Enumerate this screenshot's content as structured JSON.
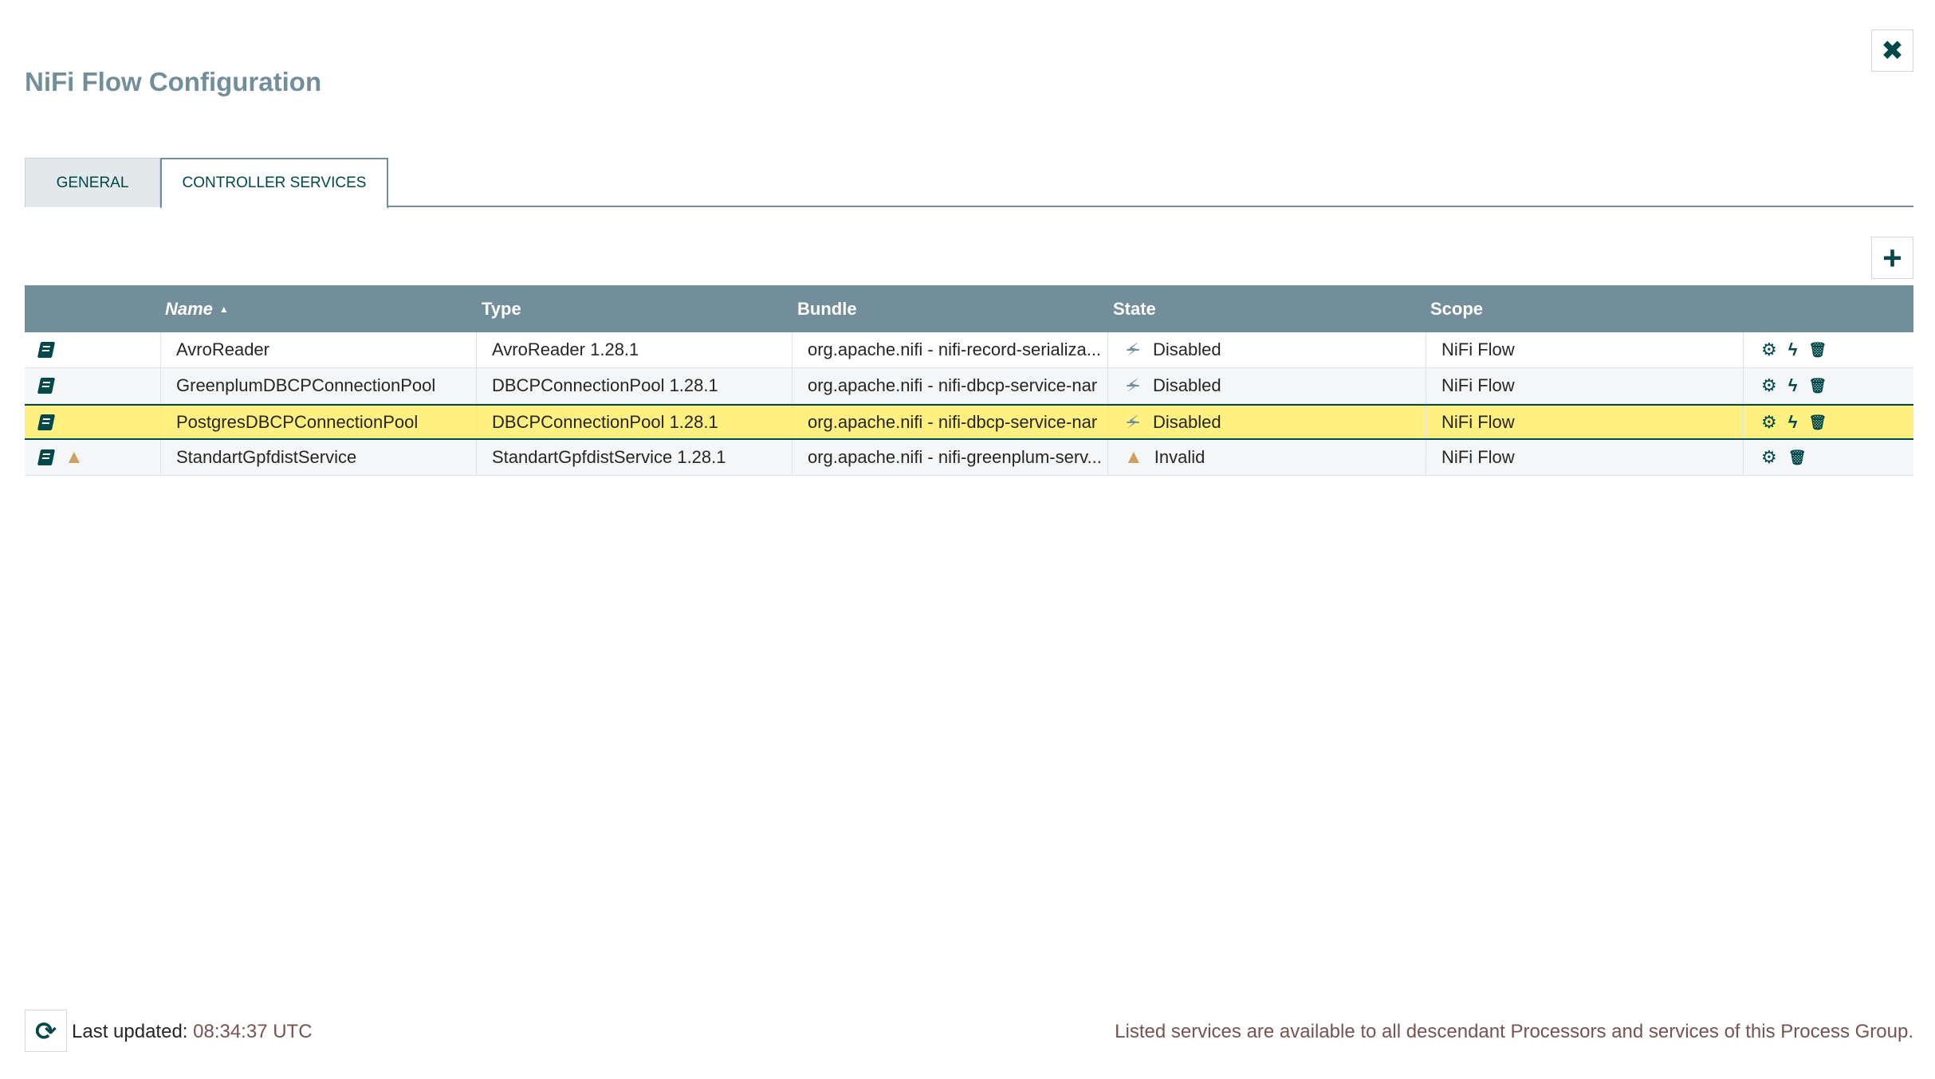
{
  "dialog": {
    "title": "NiFi Flow Configuration",
    "close_glyph": "✖"
  },
  "tabs": [
    {
      "label": "GENERAL",
      "active": false
    },
    {
      "label": "CONTROLLER SERVICES",
      "active": true
    }
  ],
  "add_glyph": "+",
  "table": {
    "columns": [
      "",
      "Name",
      "Type",
      "Bundle",
      "State",
      "Scope",
      ""
    ],
    "sort": {
      "column": "Name",
      "direction": "ascending",
      "glyph": "▲"
    },
    "rows": [
      {
        "icons": [
          "doc-icon"
        ],
        "name": "AvroReader",
        "type": "AvroReader 1.28.1",
        "bundle": "org.apache.nifi - nifi-record-serializa...",
        "state_icon": "disabled-icon",
        "state_glyph": "⚡",
        "state": "Disabled",
        "scope": "NiFi Flow",
        "actions": [
          "configure-icon",
          "enable-icon",
          "delete-icon"
        ],
        "selected": false
      },
      {
        "icons": [
          "doc-icon"
        ],
        "name": "GreenplumDBCPConnectionPool",
        "type": "DBCPConnectionPool 1.28.1",
        "bundle": "org.apache.nifi - nifi-dbcp-service-nar",
        "state_icon": "disabled-icon",
        "state_glyph": "⚡",
        "state": "Disabled",
        "scope": "NiFi Flow",
        "actions": [
          "configure-icon",
          "enable-icon",
          "delete-icon"
        ],
        "selected": false
      },
      {
        "icons": [
          "doc-icon"
        ],
        "name": "PostgresDBCPConnectionPool",
        "type": "DBCPConnectionPool 1.28.1",
        "bundle": "org.apache.nifi - nifi-dbcp-service-nar",
        "state_icon": "disabled-icon",
        "state_glyph": "⚡",
        "state": "Disabled",
        "scope": "NiFi Flow",
        "actions": [
          "configure-icon",
          "enable-icon",
          "delete-icon"
        ],
        "selected": true
      },
      {
        "icons": [
          "doc-icon",
          "warning-icon"
        ],
        "name": "StandartGpfdistService",
        "type": "StandartGpfdistService 1.28.1",
        "bundle": "org.apache.nifi - nifi-greenplum-serv...",
        "state_icon": "warning-icon",
        "state_glyph": "▲",
        "state": "Invalid",
        "scope": "NiFi Flow",
        "actions": [
          "configure-icon",
          "delete-icon"
        ],
        "selected": false
      }
    ]
  },
  "footer": {
    "refresh_glyph": "⟳",
    "last_updated_label": "Last updated:",
    "last_updated_value": "08:34:37 UTC",
    "note": "Listed services are available to all descendant Processors and services of this Process Group."
  },
  "colors": {
    "header_bg": "#728e9b",
    "accent": "#004849",
    "selected_row": "#fff07f",
    "warning": "#cf9f5d",
    "timestamp": "#775351"
  }
}
